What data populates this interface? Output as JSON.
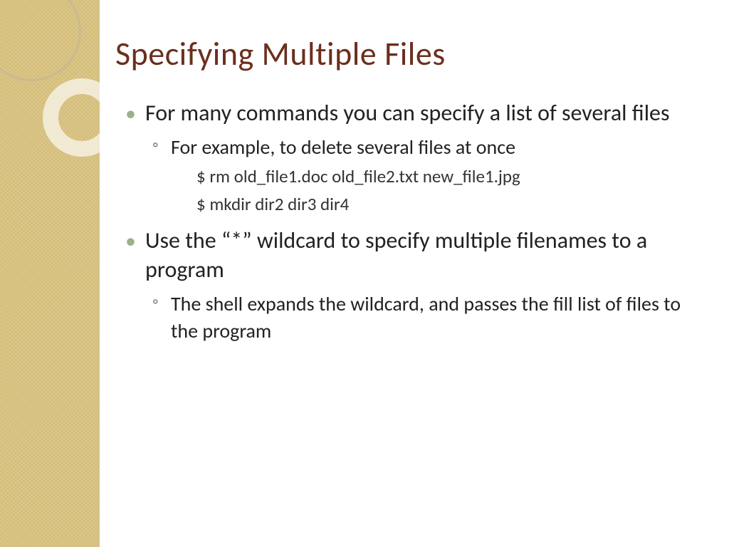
{
  "title": "Specifying Multiple Files",
  "bullets": [
    {
      "text": "For many commands you can specify a list of several files",
      "sub": [
        {
          "text": "For example, to delete several files at once"
        }
      ],
      "commands": [
        "$ rm old_file1.doc old_file2.txt new_file1.jpg",
        "$ mkdir  dir2 dir3 dir4"
      ]
    },
    {
      "text": "Use the “*” wildcard to specify multiple filenames to a program",
      "sub": [
        {
          "text": "The shell expands the wildcard, and passes the fill list of files to the program"
        }
      ],
      "commands": []
    }
  ]
}
